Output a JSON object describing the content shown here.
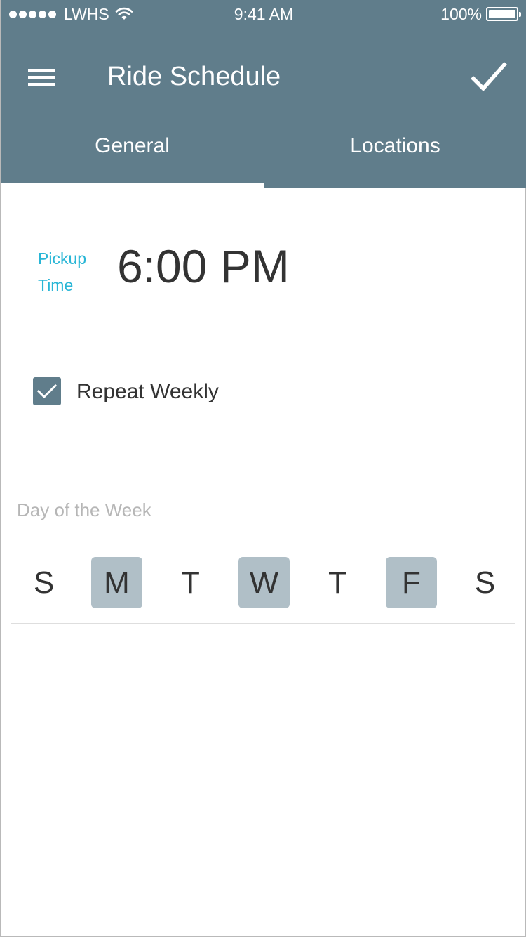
{
  "status_bar": {
    "carrier": "LWHS",
    "time": "9:41 AM",
    "battery": "100%",
    "signal_icon": "signal-dots-icon",
    "wifi_icon": "wifi-icon",
    "battery_icon": "battery-icon"
  },
  "toolbar": {
    "title": "Ride Schedule",
    "menu_icon": "menu-icon",
    "done_icon": "check-icon"
  },
  "tabs": [
    {
      "label": "General",
      "active": true
    },
    {
      "label": "Locations",
      "active": false
    }
  ],
  "pickup": {
    "label_line1": "Pickup",
    "label_line2": "Time",
    "value": "6:00 PM"
  },
  "repeat": {
    "label": "Repeat Weekly",
    "checked": true
  },
  "day_of_week": {
    "heading": "Day of the Week",
    "days": [
      {
        "label": "S",
        "selected": false
      },
      {
        "label": "M",
        "selected": true
      },
      {
        "label": "T",
        "selected": false
      },
      {
        "label": "W",
        "selected": true
      },
      {
        "label": "T",
        "selected": false
      },
      {
        "label": "F",
        "selected": true
      },
      {
        "label": "S",
        "selected": false
      }
    ]
  },
  "colors": {
    "header_bg": "#607d8b",
    "accent_label": "#29b6d6",
    "selected_day_bg": "#b0bfc7",
    "checkbox_bg": "#607d8b"
  }
}
